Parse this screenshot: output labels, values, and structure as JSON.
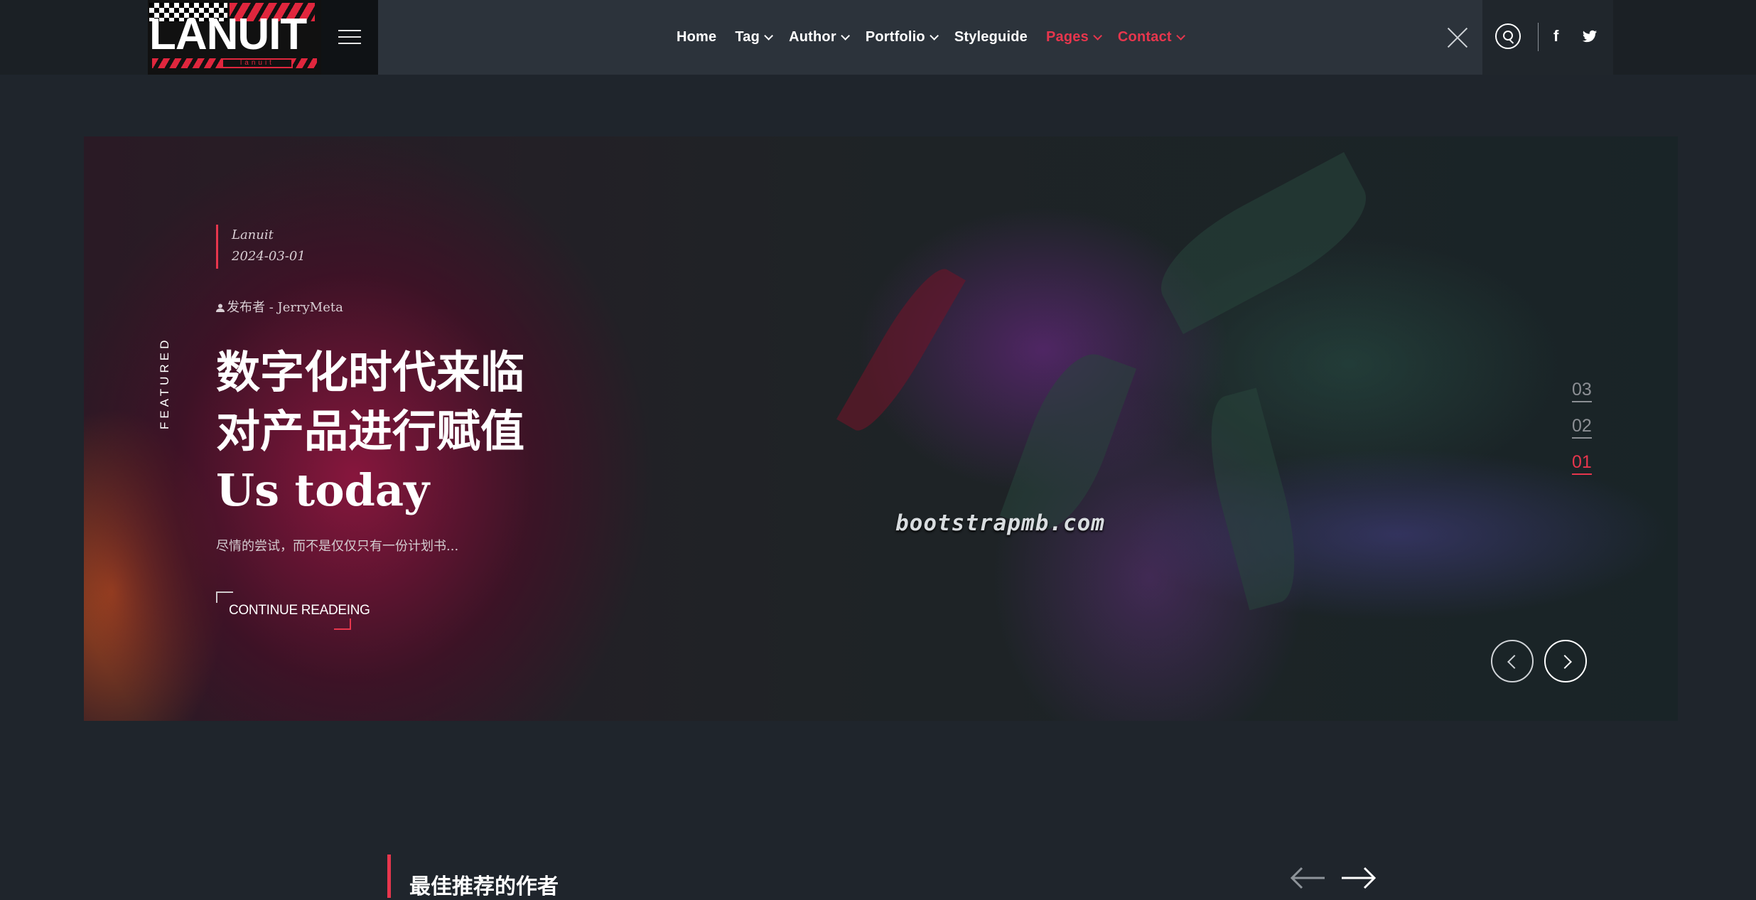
{
  "header": {
    "logo_text": "LANUIT",
    "logo_subtext": "lanuit",
    "nav": [
      {
        "label": "Home",
        "has_dropdown": false,
        "active": false
      },
      {
        "label": "Tag",
        "has_dropdown": true,
        "active": false
      },
      {
        "label": "Author",
        "has_dropdown": true,
        "active": false
      },
      {
        "label": "Portfolio",
        "has_dropdown": true,
        "active": false
      },
      {
        "label": "Styleguide",
        "has_dropdown": false,
        "active": false
      },
      {
        "label": "Pages",
        "has_dropdown": true,
        "active": true
      },
      {
        "label": "Contact",
        "has_dropdown": true,
        "active": true
      }
    ],
    "icons": [
      "hamburger-icon",
      "close-icon",
      "search-icon",
      "facebook-icon",
      "twitter-icon"
    ]
  },
  "hero": {
    "vertical_label": "FEATURED",
    "category": "Lanuit",
    "date": "2024-03-01",
    "author": "发布者 - JerryMeta",
    "heading_lines": [
      "数字化时代来临",
      "对产品进行赋值",
      "Us today"
    ],
    "excerpt": "尽情的尝试，而不是仅仅只有一份计划书...",
    "button_label": "CONTINUE READEING",
    "watermark": "bootstrapmb.com",
    "slide_numbers": [
      "03",
      "02",
      "01"
    ],
    "active_slide": "01"
  },
  "section": {
    "title": "最佳推荐的作者"
  },
  "colors": {
    "accent": "#e7364d",
    "background": "#1f252c",
    "header": "#2c333b"
  }
}
